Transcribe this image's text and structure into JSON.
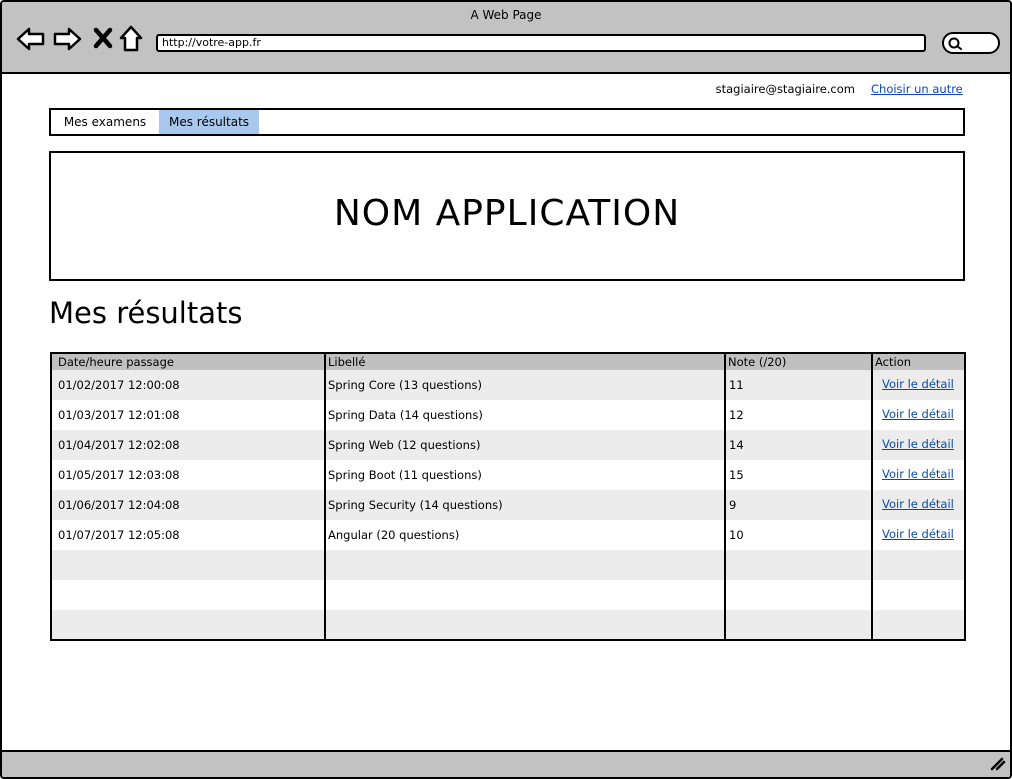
{
  "window": {
    "title": "A Web Page",
    "url": "http://votre-app.fr"
  },
  "user": {
    "email": "stagiaire@stagiaire.com",
    "switch_link": "Choisir un autre"
  },
  "tabs": [
    {
      "label": "Mes examens",
      "active": false
    },
    {
      "label": "Mes résultats",
      "active": true
    }
  ],
  "banner": {
    "title": "NOM APPLICATION"
  },
  "section": {
    "heading": "Mes résultats"
  },
  "table": {
    "headers": [
      "Date/heure passage",
      "Libellé",
      "Note (/20)",
      "Action"
    ],
    "rows": [
      {
        "date": "01/02/2017 12:00:08",
        "libelle": "Spring Core (13 questions)",
        "note": "11",
        "action": "Voir le détail"
      },
      {
        "date": "01/03/2017 12:01:08",
        "libelle": "Spring Data (14 questions)",
        "note": "12",
        "action": "Voir le détail"
      },
      {
        "date": "01/04/2017 12:02:08",
        "libelle": "Spring Web (12 questions)",
        "note": "14",
        "action": "Voir le détail"
      },
      {
        "date": "01/05/2017 12:03:08",
        "libelle": "Spring Boot (11 questions)",
        "note": "15",
        "action": "Voir le détail"
      },
      {
        "date": "01/06/2017 12:04:08",
        "libelle": "Spring Security (14 questions)",
        "note": "9",
        "action": "Voir le détail"
      },
      {
        "date": "01/07/2017 12:05:08",
        "libelle": "Angular (20 questions)",
        "note": "10",
        "action": "Voir le détail"
      }
    ],
    "empty_rows": 3
  },
  "icons": {
    "back": "back-arrow-icon",
    "forward": "forward-arrow-icon",
    "stop": "close-icon",
    "home": "home-icon",
    "search": "search-icon",
    "resize": "resize-grip-icon"
  },
  "colors": {
    "chrome": "#c2c2c2",
    "active_tab": "#a8c8ee",
    "link": "#0a4aa8",
    "row_alt": "#ececec",
    "header_bg": "#c0c0c0"
  }
}
